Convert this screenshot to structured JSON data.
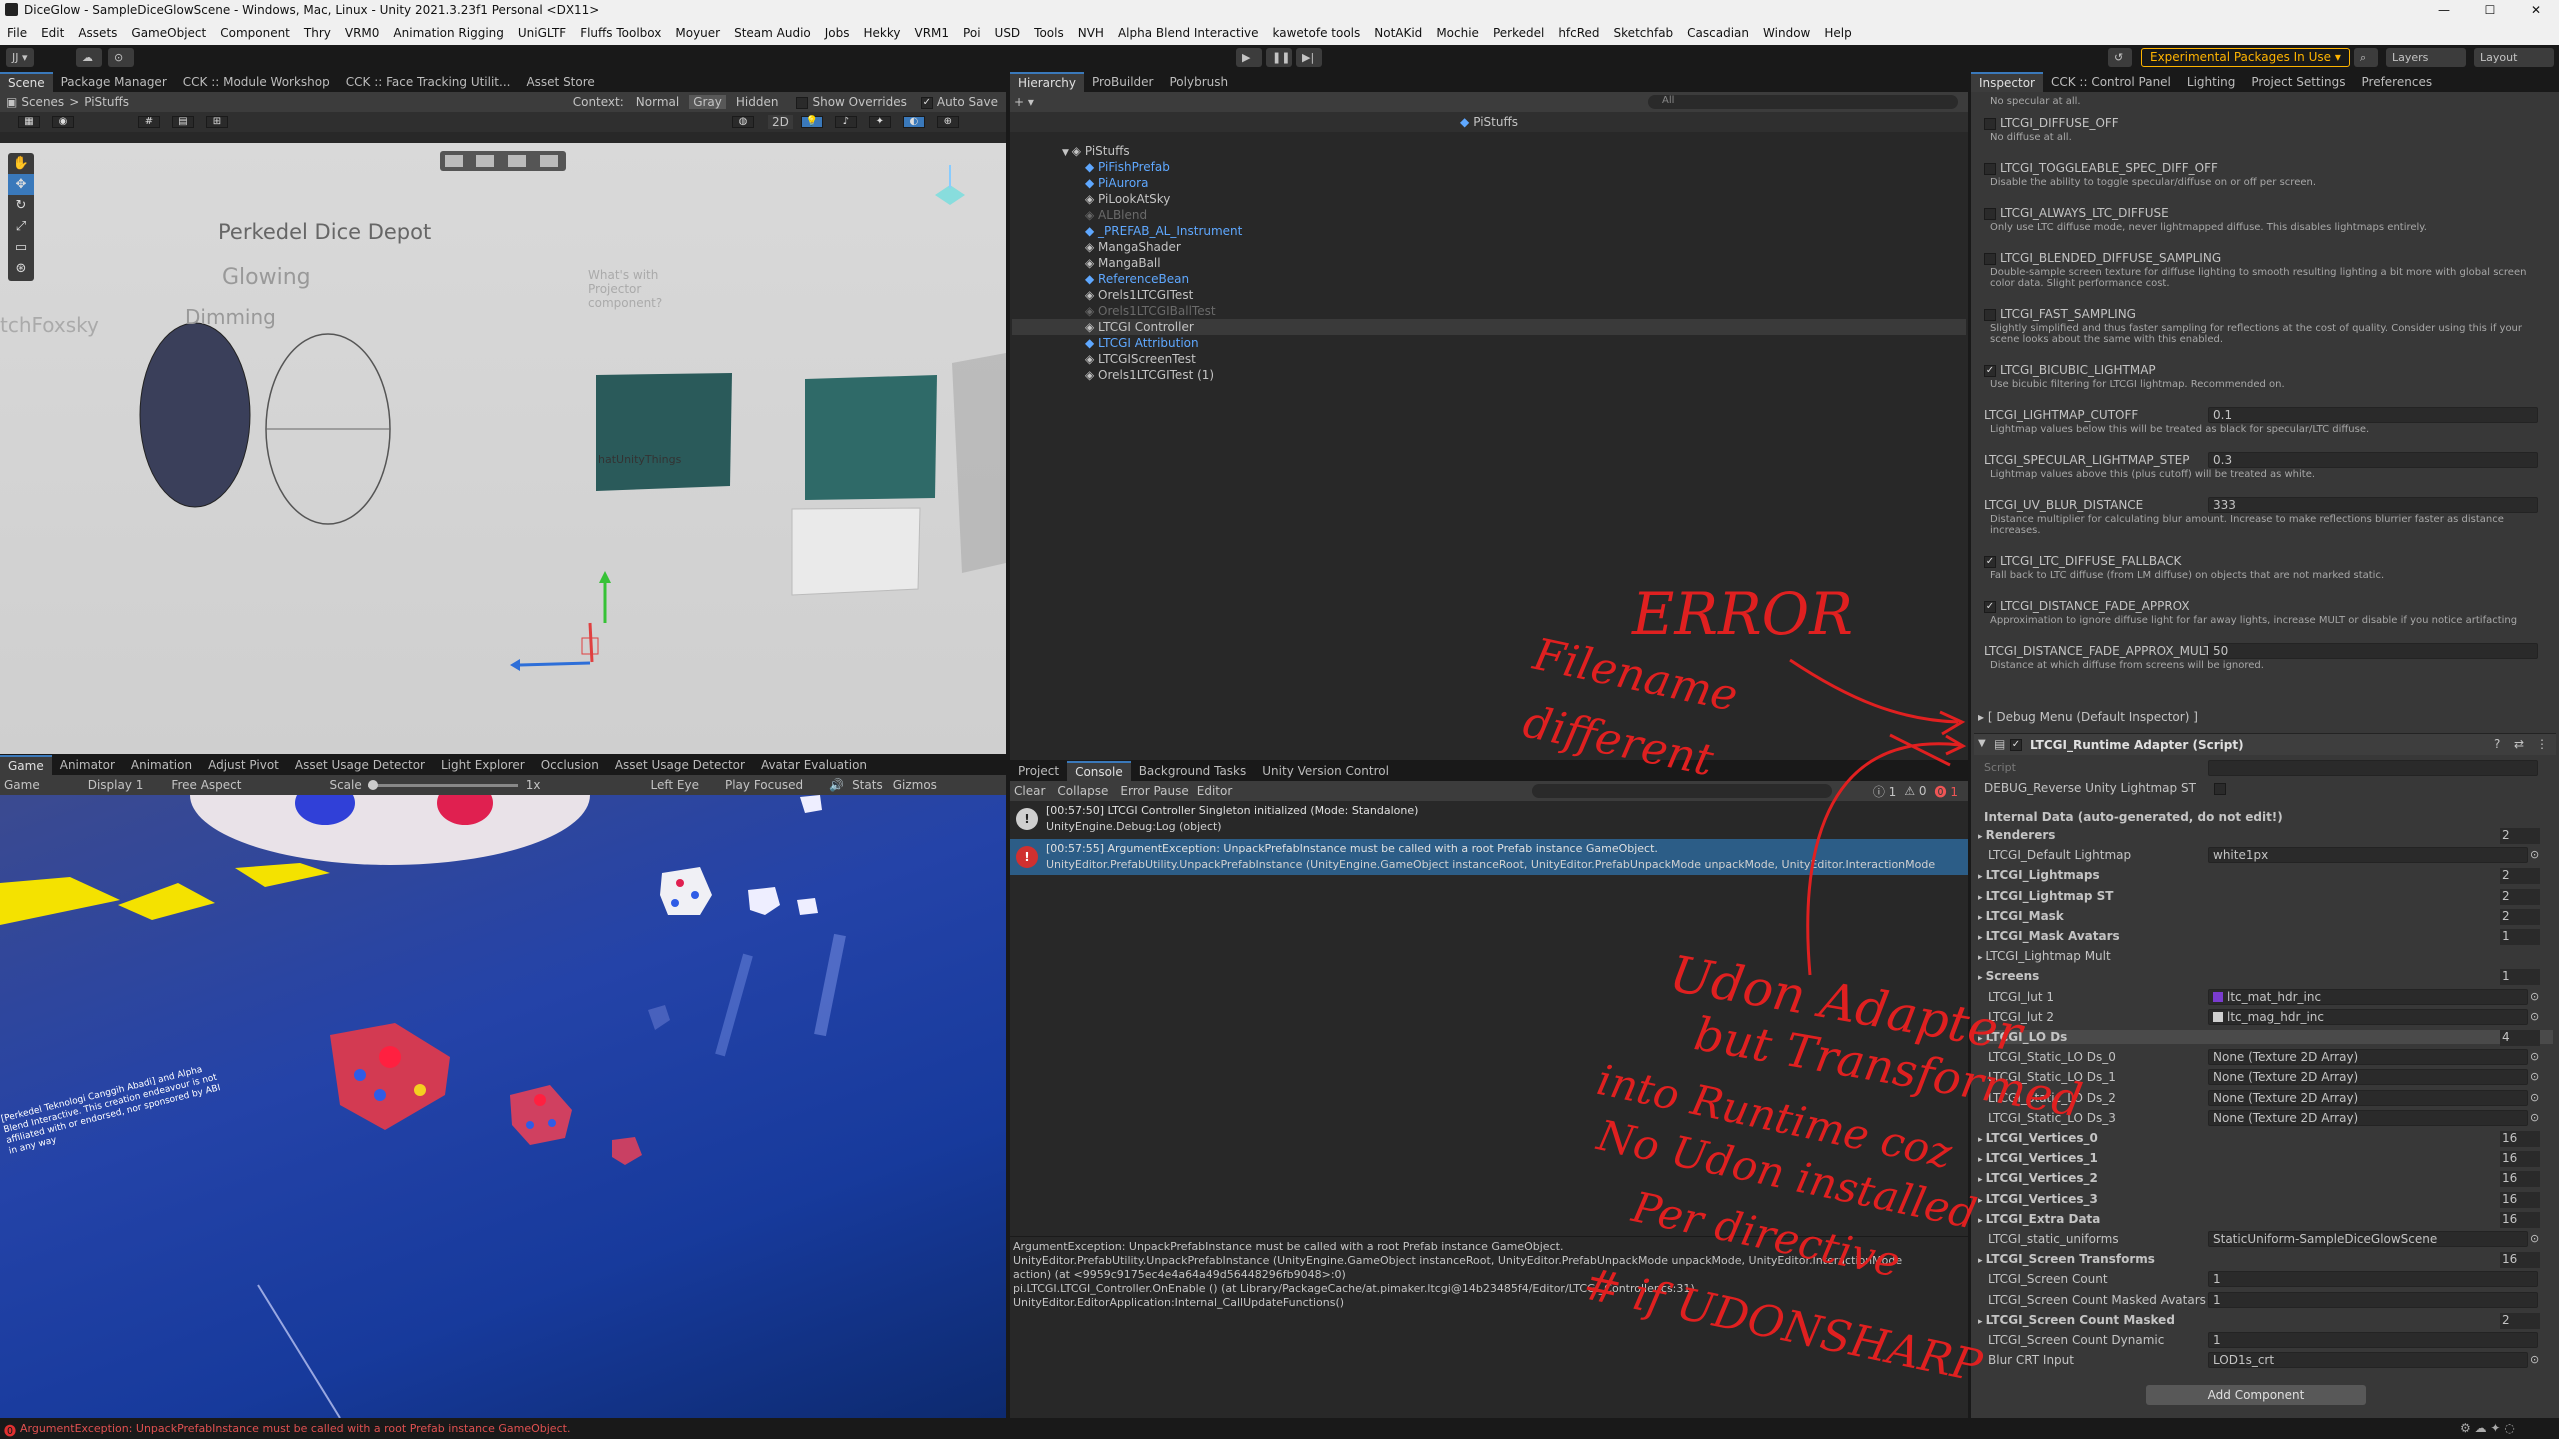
{
  "window": {
    "title": "DiceGlow - SampleDiceGlowScene - Windows, Mac, Linux - Unity 2021.3.23f1 Personal <DX11>",
    "controls": [
      "—",
      "☐",
      "✕"
    ]
  },
  "menu": [
    "File",
    "Edit",
    "Assets",
    "GameObject",
    "Component",
    "Thry",
    "VRM0",
    "Animation Rigging",
    "UniGLTF",
    "Fluffs Toolbox",
    "Moyuer",
    "Steam Audio",
    "Jobs",
    "Hekky",
    "VRM1",
    "Poi",
    "USD",
    "Tools",
    "NVH",
    "Alpha Blend Interactive",
    "kawetofe tools",
    "NotAKid",
    "Mochie",
    "Perkedel",
    "hfcRed",
    "Sketchfab",
    "Cascadian",
    "Window",
    "Help"
  ],
  "toolbar": {
    "account": "JJ ▾",
    "experimental": "Experimental Packages In Use ▾",
    "layers": "Layers",
    "layout": "Layout"
  },
  "scene_tabs": [
    "Scene",
    "Package Manager",
    "CCK :: Module Workshop",
    "CCK :: Face Tracking Utilit...",
    "Asset Store"
  ],
  "scene_bar": {
    "crumb1": "Scenes",
    "crumb2": "PiStuffs",
    "context": "Context:",
    "normal": "Normal",
    "gray": "Gray",
    "hidden": "Hidden",
    "show_overrides": "Show Overrides",
    "auto_save": "Auto Save",
    "mode_2d": "2D"
  },
  "scene_view": {
    "sign": "Perkedel Dice Depot",
    "glowing": "Glowing",
    "dimming": "Dimming",
    "sketch": "tchFoxsky",
    "question": "What's with Projector component?",
    "panel_label": "hatUnityThings"
  },
  "hier_tabs": [
    "Hierarchy",
    "ProBuilder",
    "Polybrush"
  ],
  "hierarchy": {
    "search": "All",
    "header": "PiStuffs",
    "items": [
      {
        "name": "PiStuffs",
        "style": "root"
      },
      {
        "name": "PiFishPrefab",
        "style": "blue"
      },
      {
        "name": "PiAurora",
        "style": "blue"
      },
      {
        "name": "PiLookAtSky",
        "style": "normal"
      },
      {
        "name": "ALBlend",
        "style": "dim"
      },
      {
        "name": "_PREFAB_AL_Instrument",
        "style": "blue"
      },
      {
        "name": "MangaShader",
        "style": "normal"
      },
      {
        "name": "MangaBall",
        "style": "normal"
      },
      {
        "name": "ReferenceBean",
        "style": "blue"
      },
      {
        "name": "Orels1LTCGITest",
        "style": "normal"
      },
      {
        "name": "Orels1LTCGIBallTest",
        "style": "dim"
      },
      {
        "name": "LTCGI Controller",
        "style": "sel"
      },
      {
        "name": "LTCGI Attribution",
        "style": "blue"
      },
      {
        "name": "LTCGIScreenTest",
        "style": "normal"
      },
      {
        "name": "Orels1LTCGITest (1)",
        "style": "normal"
      }
    ]
  },
  "game_tabs": [
    "Game",
    "Animator",
    "Animation",
    "Adjust Pivot",
    "Asset Usage Detector",
    "Light Explorer",
    "Occlusion",
    "Asset Usage Detector",
    "Avatar Evaluation"
  ],
  "game_bar": {
    "mode": "Game",
    "display": "Display 1",
    "aspect": "Free Aspect",
    "scale": "Scale",
    "scale_val": "1x",
    "eye": "Left Eye",
    "focus": "Play Focused",
    "stats": "Stats",
    "gizmos": "Gizmos"
  },
  "game_view": {
    "credit": "[Perkedel Teknologi Canggih Abadi] and Alpha Blend Interactive. This creation endeavour is not affiliated with or endorsed, nor sponsored by ABI in any way"
  },
  "console_tabs": [
    "Project",
    "Console",
    "Background Tasks",
    "Unity Version Control"
  ],
  "console_bar": {
    "clear": "Clear",
    "collapse": "Collapse",
    "error_pause": "Error Pause",
    "editor": "Editor",
    "log_count": "1",
    "warn_count": "0",
    "err_count": "1"
  },
  "console_entries": [
    {
      "type": "log",
      "line1": "[00:57:50] LTCGI Controller Singleton initialized (Mode: Standalone)",
      "line2": "UnityEngine.Debug:Log (object)"
    },
    {
      "type": "error",
      "line1": "[00:57:55] ArgumentException: UnpackPrefabInstance must be called with a root Prefab instance GameObject.",
      "line2": "UnityEditor.PrefabUtility.UnpackPrefabInstance (UnityEngine.GameObject instanceRoot, UnityEditor.PrefabUnpackMode unpackMode, UnityEditor.InteractionMode"
    }
  ],
  "console_detail": [
    "ArgumentException: UnpackPrefabInstance must be called with a root Prefab instance GameObject.",
    "UnityEditor.PrefabUtility.UnpackPrefabInstance (UnityEngine.GameObject instanceRoot, UnityEditor.PrefabUnpackMode unpackMode, UnityEditor.InteractionMode",
    "action) (at <9959c9175ec4e4a64a49d56448296fb9048>:0)",
    "pi.LTCGI.LTCGI_Controller.OnEnable () (at Library/PackageCache/at.pimaker.ltcgi@14b23485f4/Editor/LTCGI_Controller.cs:31)",
    "UnityEditor.EditorApplication:Internal_CallUpdateFunctions()"
  ],
  "inspector_tabs": [
    "Inspector",
    "CCK :: Control Panel",
    "Lighting",
    "Project Settings",
    "Preferences"
  ],
  "inspector_top": [
    {
      "t": "chk",
      "label": "",
      "desc": "No specular at all."
    },
    {
      "t": "chk",
      "label": "LTCGI_DIFFUSE_OFF",
      "desc": "No diffuse at all."
    },
    {
      "t": "chk",
      "label": "LTCGI_TOGGLEABLE_SPEC_DIFF_OFF",
      "desc": "Disable the ability to toggle specular/diffuse on or off per screen."
    },
    {
      "t": "chk",
      "label": "LTCGI_ALWAYS_LTC_DIFFUSE",
      "desc": "Only use LTC diffuse mode, never lightmapped diffuse. This disables lightmaps entirely."
    },
    {
      "t": "chk",
      "label": "LTCGI_BLENDED_DIFFUSE_SAMPLING",
      "desc": "Double-sample screen texture for diffuse lighting to smooth resulting lighting a bit more with global screen color data. Slight performance cost."
    },
    {
      "t": "chk",
      "label": "LTCGI_FAST_SAMPLING",
      "desc": "Slightly simplified and thus faster sampling for reflections at the cost of quality. Consider using this if your scene looks about the same with this enabled."
    },
    {
      "t": "chk",
      "on": true,
      "label": "LTCGI_BICUBIC_LIGHTMAP",
      "desc": "Use bicubic filtering for LTCGI lightmap. Recommended on."
    },
    {
      "t": "val",
      "label": "LTCGI_LIGHTMAP_CUTOFF",
      "value": "0.1",
      "desc": "Lightmap values below this will be treated as black for specular/LTC diffuse."
    },
    {
      "t": "val",
      "label": "LTCGI_SPECULAR_LIGHTMAP_STEP",
      "value": "0.3",
      "desc": "Lightmap values above this (plus cutoff) will be treated as white."
    },
    {
      "t": "val",
      "label": "LTCGI_UV_BLUR_DISTANCE",
      "value": "333",
      "desc": "Distance multiplier for calculating blur amount. Increase to make reflections blurrier faster as distance increases."
    },
    {
      "t": "chk",
      "on": true,
      "label": "LTCGI_LTC_DIFFUSE_FALLBACK",
      "desc": "Fall back to LTC diffuse (from LM diffuse) on objects that are not marked static."
    },
    {
      "t": "chk",
      "on": true,
      "label": "LTCGI_DISTANCE_FADE_APPROX",
      "desc": "Approximation to ignore diffuse light for far away lights, increase MULT or disable if you notice artifacting"
    },
    {
      "t": "val",
      "label": "LTCGI_DISTANCE_FADE_APPROX_MULT",
      "value": "50",
      "desc": "Distance at which diffuse from screens will be ignored."
    }
  ],
  "inspector_debug": "[ Debug Menu (Default Inspector) ]",
  "component": {
    "title": "LTCGI_Runtime Adapter (Script)",
    "script_label": "Script",
    "debug_label": "DEBUG_Reverse Unity Lightmap ST",
    "internal": "Internal Data (auto-generated, do not edit!)"
  },
  "component_rows": [
    {
      "label": "Renderers",
      "value": "2",
      "bold": true,
      "fold": true
    },
    {
      "label": "LTCGI_Default Lightmap",
      "obj": "white1px"
    },
    {
      "label": "LTCGI_Lightmaps",
      "value": "2",
      "bold": true,
      "fold": true
    },
    {
      "label": "LTCGI_Lightmap ST",
      "value": "2",
      "bold": true,
      "fold": true
    },
    {
      "label": "LTCGI_Mask",
      "value": "2",
      "bold": true,
      "fold": true
    },
    {
      "label": "LTCGI_Mask Avatars",
      "value": "1",
      "bold": true,
      "fold": true
    },
    {
      "label": "LTCGI_Lightmap Mult",
      "value": "",
      "fold": true
    },
    {
      "label": "Screens",
      "value": "1",
      "bold": true,
      "fold": true
    },
    {
      "label": "LTCGI_lut 1",
      "obj": "ltc_mat_hdr_inc",
      "swatch": "#7a3ccf"
    },
    {
      "label": "LTCGI_lut 2",
      "obj": "ltc_mag_hdr_inc",
      "swatch": "#d0d0d0"
    },
    {
      "label": "LTCGI_LO Ds",
      "value": "4",
      "bold": true,
      "fold": true,
      "hl": true
    },
    {
      "label": "LTCGI_Static_LO Ds_0",
      "obj": "None (Texture 2D Array)"
    },
    {
      "label": "LTCGI_Static_LO Ds_1",
      "obj": "None (Texture 2D Array)"
    },
    {
      "label": "LTCGI_Static_LO Ds_2",
      "obj": "None (Texture 2D Array)"
    },
    {
      "label": "LTCGI_Static_LO Ds_3",
      "obj": "None (Texture 2D Array)"
    },
    {
      "label": "LTCGI_Vertices_0",
      "value": "16",
      "bold": true,
      "fold": true
    },
    {
      "label": "LTCGI_Vertices_1",
      "value": "16",
      "bold": true,
      "fold": true
    },
    {
      "label": "LTCGI_Vertices_2",
      "value": "16",
      "bold": true,
      "fold": true
    },
    {
      "label": "LTCGI_Vertices_3",
      "value": "16",
      "bold": true,
      "fold": true
    },
    {
      "label": "LTCGI_Extra Data",
      "value": "16",
      "bold": true,
      "fold": true
    },
    {
      "label": "LTCGI_static_uniforms",
      "obj": "StaticUniform-SampleDiceGlowScene"
    },
    {
      "label": "LTCGI_Screen Transforms",
      "value": "16",
      "bold": true,
      "fold": true
    },
    {
      "label": "LTCGI_Screen Count",
      "num": "1"
    },
    {
      "label": "LTCGI_Screen Count Masked Avatars",
      "num": "1"
    },
    {
      "label": "LTCGI_Screen Count Masked",
      "value": "2",
      "bold": true,
      "fold": true
    },
    {
      "label": "LTCGI_Screen Count Dynamic",
      "num": "1"
    },
    {
      "label": "Blur CRT Input",
      "obj": "LOD1s_crt"
    }
  ],
  "add_component": "Add Component",
  "status": "ArgumentException: UnpackPrefabInstance must be called with a root Prefab instance GameObject.",
  "annotations": {
    "error": "ERROR",
    "filename": "Filename",
    "different": "different",
    "udon1": "Udon Adapter",
    "udon2": "but Transformed",
    "udon3": "into Runtime coz",
    "udon4": "No Udon installed",
    "udon5": "Per directive",
    "udon6": "# if UDONSHARP"
  },
  "colors": {
    "accent": "#3a79bb",
    "error": "#e02020",
    "warning_badge": "#ffb400"
  }
}
